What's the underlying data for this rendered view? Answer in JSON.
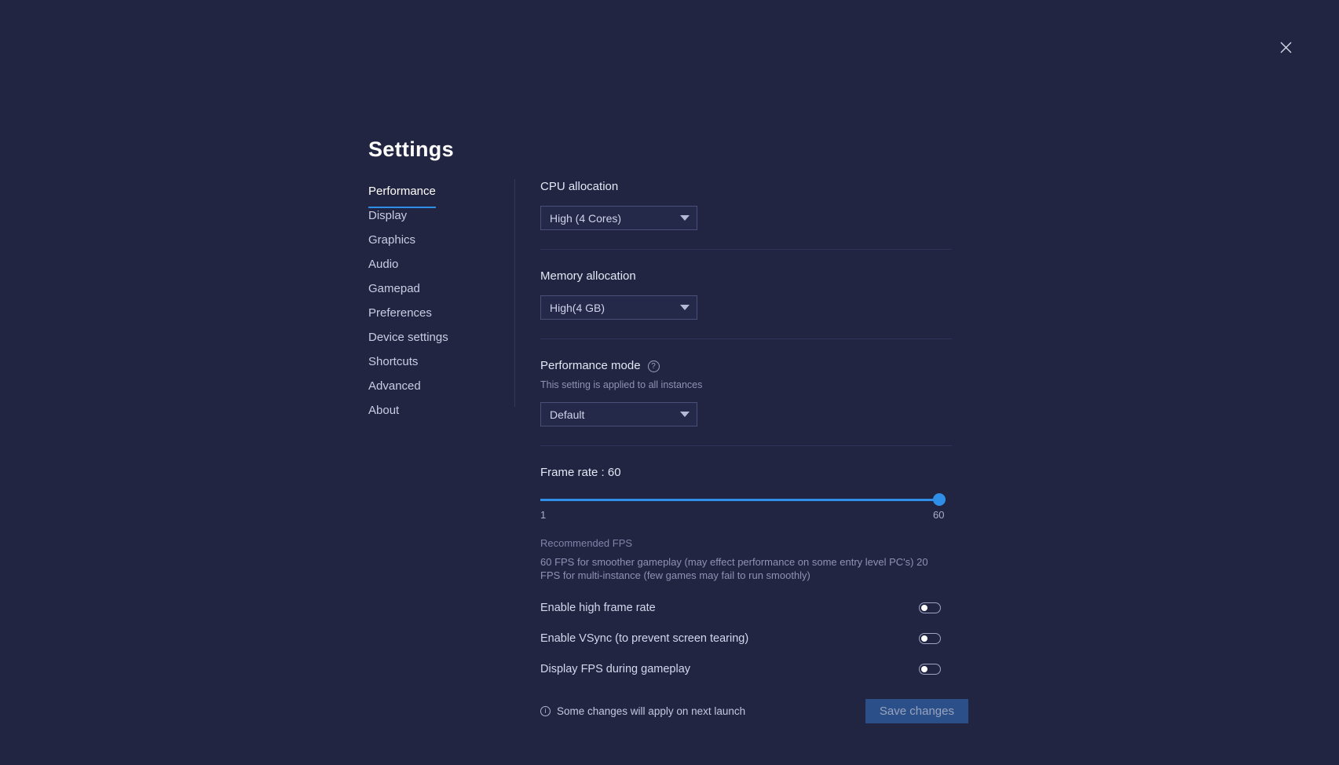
{
  "window": {
    "title": "Settings",
    "close_icon": "close-icon",
    "background_color": "#222541",
    "accent_color": "#2f8fe8"
  },
  "sidebar": {
    "items": [
      {
        "label": "Performance",
        "active": true
      },
      {
        "label": "Display",
        "active": false
      },
      {
        "label": "Graphics",
        "active": false
      },
      {
        "label": "Audio",
        "active": false
      },
      {
        "label": "Gamepad",
        "active": false
      },
      {
        "label": "Preferences",
        "active": false
      },
      {
        "label": "Device settings",
        "active": false
      },
      {
        "label": "Shortcuts",
        "active": false
      },
      {
        "label": "Advanced",
        "active": false
      },
      {
        "label": "About",
        "active": false
      }
    ]
  },
  "main": {
    "cpu": {
      "label": "CPU allocation",
      "value": "High (4 Cores)"
    },
    "memory": {
      "label": "Memory allocation",
      "value": "High(4 GB)"
    },
    "performance_mode": {
      "label": "Performance mode",
      "help_icon": "help-circle-icon",
      "sublabel": "This setting is applied to all instances",
      "value": "Default"
    },
    "frame_rate": {
      "label": "Frame rate : 60",
      "value": 60,
      "min": 1,
      "max": 60,
      "min_label": "1",
      "max_label": "60",
      "fill_percent": 100,
      "recommended_title": "Recommended FPS",
      "recommended_body": "60 FPS for smoother gameplay (may effect performance on some entry level PC's) 20 FPS for multi-instance (few games may fail to run smoothly)"
    },
    "toggles": [
      {
        "label": "Enable high frame rate",
        "on": false
      },
      {
        "label": "Enable VSync (to prevent screen tearing)",
        "on": false
      },
      {
        "label": "Display FPS during gameplay",
        "on": false
      }
    ],
    "footer": {
      "info_icon": "info-icon",
      "note": "Some changes will apply on next launch",
      "save_label": "Save changes"
    }
  }
}
